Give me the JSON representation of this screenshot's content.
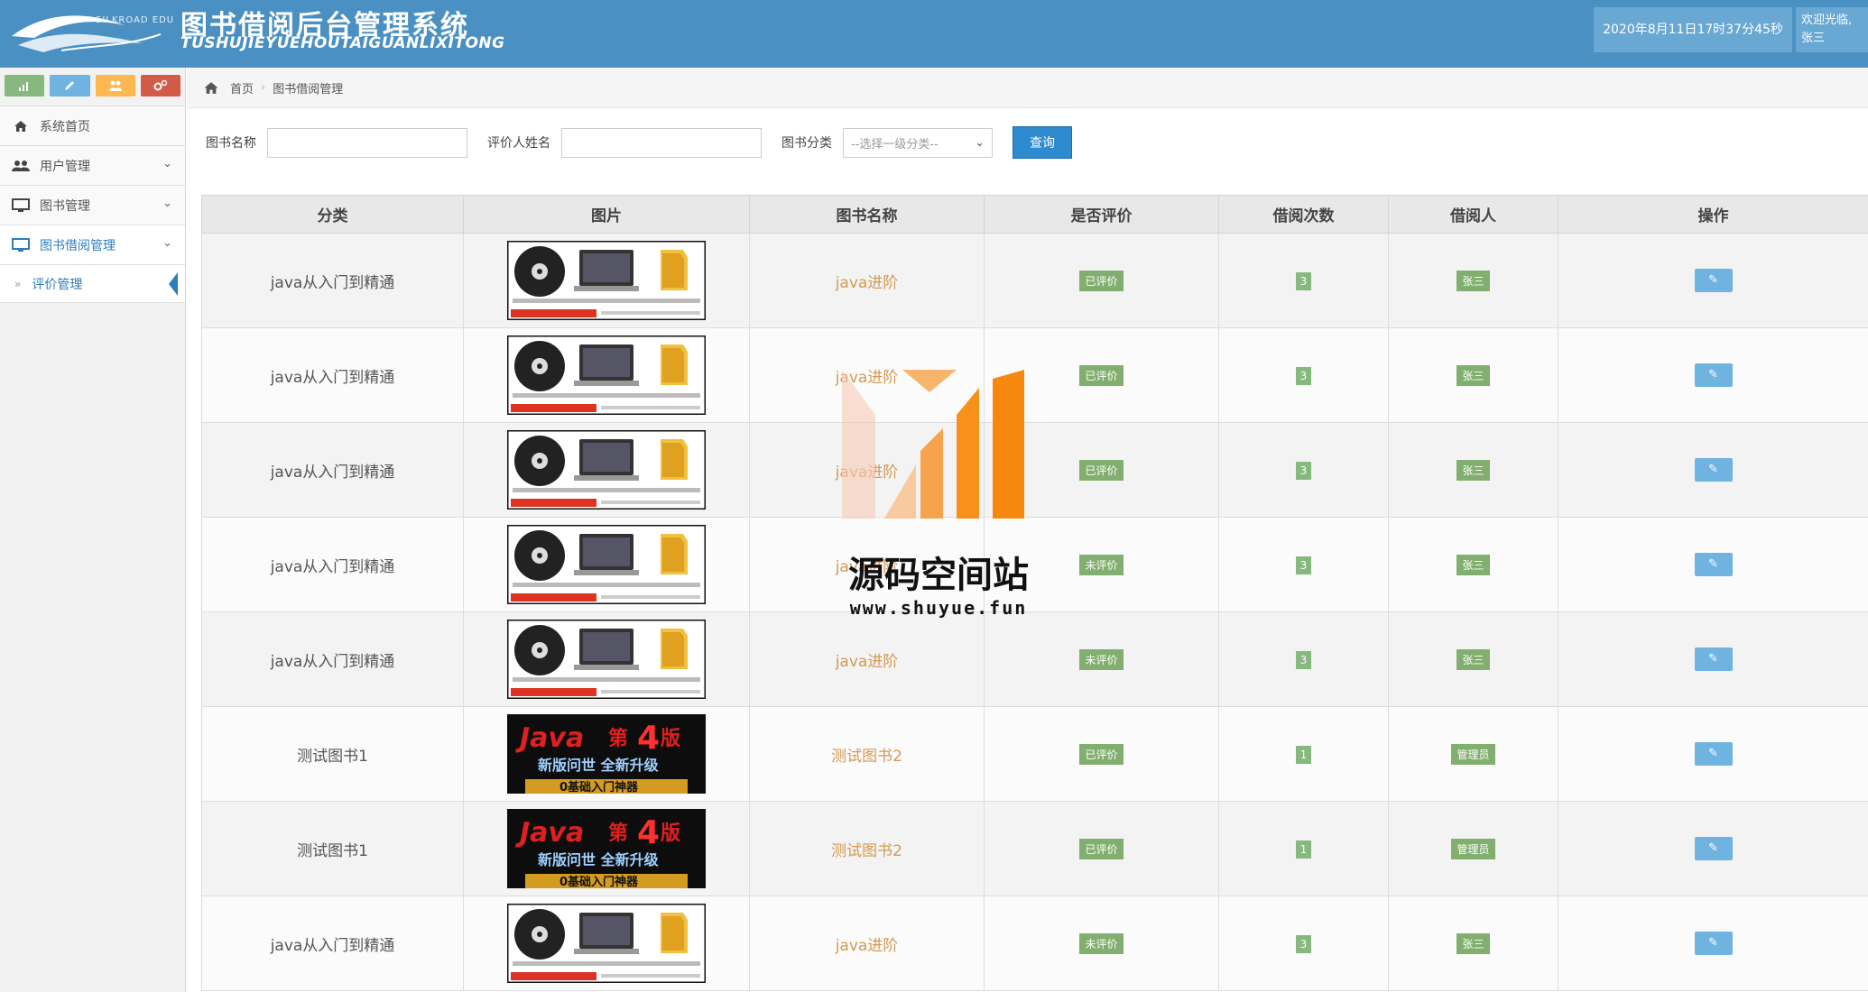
{
  "header": {
    "logo_text": "SILKROAD EDU",
    "title": "图书借阅后台管理系统",
    "subtitle": "TUSHUJIEYUEHOUTAIGUANLIXITONG",
    "datetime": "2020年8月11日17时37分45秒",
    "welcome": "欢迎光临,",
    "username": "张三"
  },
  "shortcuts": [
    {
      "icon": "chart-icon",
      "color": "#87b87f"
    },
    {
      "icon": "pencil-icon",
      "color": "#6fb3e0"
    },
    {
      "icon": "users-icon",
      "color": "#ffb752"
    },
    {
      "icon": "cogs-icon",
      "color": "#d15b47"
    }
  ],
  "sidebar": {
    "items": [
      {
        "label": "系统首页",
        "icon": "home-icon"
      },
      {
        "label": "用户管理",
        "icon": "users-icon"
      },
      {
        "label": "图书管理",
        "icon": "desktop-icon"
      },
      {
        "label": "图书借阅管理",
        "icon": "desktop-icon"
      }
    ],
    "sub_item": "评价管理"
  },
  "breadcrumb": {
    "home": "首页",
    "current": "图书借阅管理"
  },
  "search": {
    "book_name_label": "图书名称",
    "book_name_value": "",
    "reviewer_label": "评价人姓名",
    "reviewer_value": "",
    "category_label": "图书分类",
    "category_selected": "--选择一级分类--",
    "query_button": "查询"
  },
  "table": {
    "headers": [
      "分类",
      "图片",
      "图书名称",
      "是否评价",
      "借阅次数",
      "借阅人",
      "操作"
    ],
    "rows": [
      {
        "category": "java从入门到精通",
        "image": "java-dvd",
        "book": "java进阶",
        "reviewed": "已评价",
        "count": "3",
        "borrower": "张三"
      },
      {
        "category": "java从入门到精通",
        "image": "java-dvd",
        "book": "java进阶",
        "reviewed": "已评价",
        "count": "3",
        "borrower": "张三"
      },
      {
        "category": "java从入门到精通",
        "image": "java-dvd",
        "book": "java进阶",
        "reviewed": "已评价",
        "count": "3",
        "borrower": "张三"
      },
      {
        "category": "java从入门到精通",
        "image": "java-dvd",
        "book": "java进阶",
        "reviewed": "未评价",
        "count": "3",
        "borrower": "张三"
      },
      {
        "category": "java从入门到精通",
        "image": "java-dvd",
        "book": "java进阶",
        "reviewed": "未评价",
        "count": "3",
        "borrower": "张三"
      },
      {
        "category": "测试图书1",
        "image": "java-4th",
        "book": "测试图书2",
        "reviewed": "已评价",
        "count": "1",
        "borrower": "管理员"
      },
      {
        "category": "测试图书1",
        "image": "java-4th",
        "book": "测试图书2",
        "reviewed": "已评价",
        "count": "1",
        "borrower": "管理员"
      },
      {
        "category": "java从入门到精通",
        "image": "java-dvd",
        "book": "java进阶",
        "reviewed": "未评价",
        "count": "3",
        "borrower": "张三"
      }
    ]
  },
  "watermark": {
    "text": "源码空间站",
    "url": "www.shuyue.fun"
  }
}
